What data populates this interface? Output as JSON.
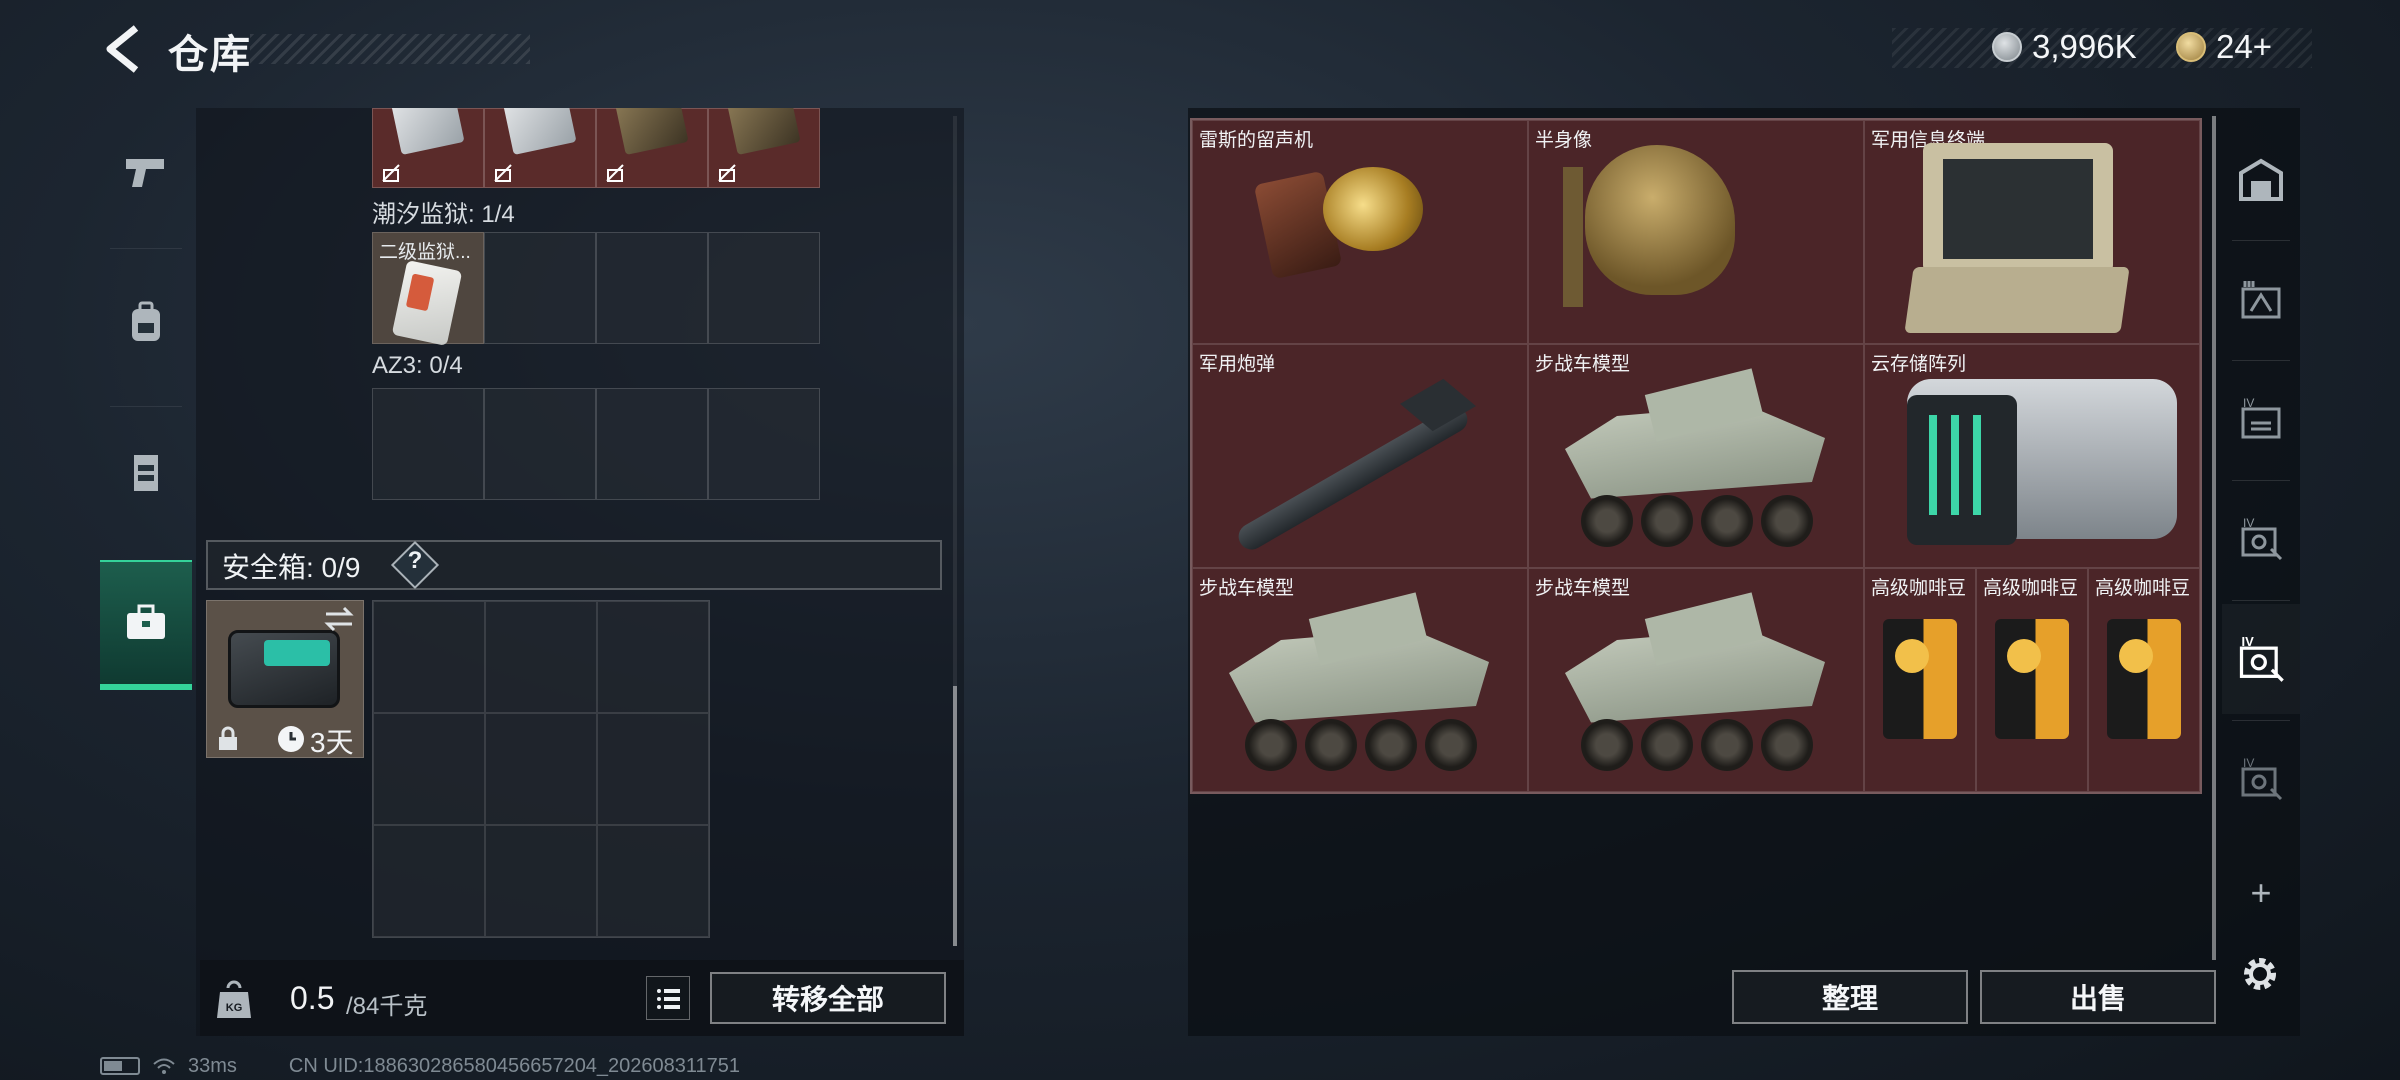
{
  "header": {
    "title": "仓库",
    "back_icon": "back-arrow-icon",
    "coins": "3,996K",
    "gems": "24+"
  },
  "left_nav": [
    {
      "icon": "pistol-icon",
      "active": false
    },
    {
      "icon": "backpack-icon",
      "active": false
    },
    {
      "icon": "vest-icon",
      "active": false
    },
    {
      "icon": "briefcase-icon",
      "active": true
    }
  ],
  "left_panel": {
    "tidal_prison_label": "潮汐监狱: 1/4",
    "tidal_prison_item": "二级监狱...",
    "az3_label": "AZ3: 0/4",
    "safebox_label": "安全箱: 0/9",
    "safebox_help": "?",
    "safebox_duration": "3天",
    "weight_current": "0.5",
    "weight_max": "/84千克",
    "transfer_all": "转移全部"
  },
  "stash_items": [
    {
      "name": "雷斯的留声机"
    },
    {
      "name": "半身像"
    },
    {
      "name": "军用信息终端"
    },
    {
      "name": "军用炮弹"
    },
    {
      "name": "步战车模型"
    },
    {
      "name": "云存储阵列"
    },
    {
      "name": "步战车模型"
    },
    {
      "name": "步战车模型"
    },
    {
      "name": "高级咖啡豆"
    },
    {
      "name": "高级咖啡豆"
    },
    {
      "name": "高级咖啡豆"
    }
  ],
  "right_nav": [
    {
      "icon": "stash-vault-icon"
    },
    {
      "icon": "crate-3-icon"
    },
    {
      "icon": "crate-4-icon"
    },
    {
      "icon": "crate-4b-icon"
    },
    {
      "icon": "crate-4-active-icon",
      "active": true
    },
    {
      "icon": "crate-4c-icon"
    }
  ],
  "buttons": {
    "sort": "整理",
    "sell": "出售",
    "add": "+"
  },
  "status": {
    "ping": "33ms",
    "uid": "CN UID:188630286580456657204_202608311751"
  },
  "colors": {
    "accent": "#34d39a",
    "stash_bg": "#4b2528"
  }
}
